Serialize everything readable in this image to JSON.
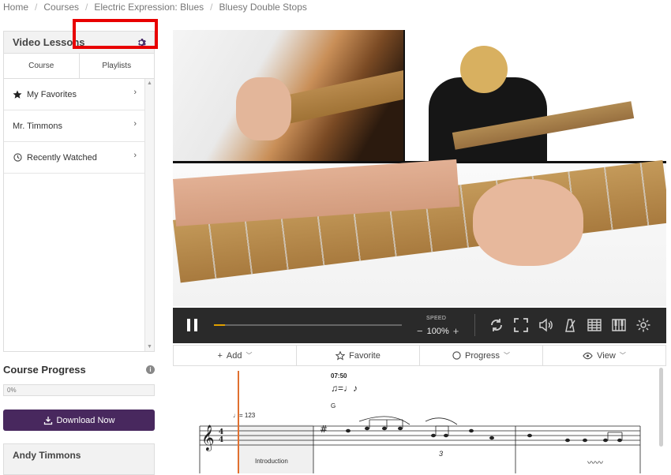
{
  "breadcrumb": [
    "Home",
    "Courses",
    "Electric Expression: Blues",
    "Bluesy Double Stops"
  ],
  "sidebar": {
    "title": "Video Lessons",
    "tabs": [
      {
        "label": "Course"
      },
      {
        "label": "Playlists"
      }
    ],
    "items": [
      {
        "label": "My Favorites",
        "icon": "star-icon"
      },
      {
        "label": "Mr. Timmons",
        "icon": ""
      },
      {
        "label": "Recently Watched",
        "icon": "clock-icon"
      }
    ]
  },
  "course_progress": {
    "title": "Course Progress",
    "percent_label": "0%",
    "value": 0
  },
  "download_label": "Download Now",
  "instructor_name": "Andy Timmons",
  "player": {
    "speed_label": "SPEED",
    "speed_value": "100%",
    "speed_minus": "−",
    "speed_plus": "+",
    "progress": 0.06
  },
  "toolbar": {
    "add": "Add",
    "favorite": "Favorite",
    "progress": "Progress",
    "view": "View"
  },
  "notation": {
    "time": "07:50",
    "chord": "G",
    "tempo": "= 123",
    "section": "Introduction"
  },
  "colors": {
    "accent": "#48285e",
    "highlight": "#e80000",
    "player_bar": "#2a2a2a",
    "cursor": "#e07030"
  }
}
